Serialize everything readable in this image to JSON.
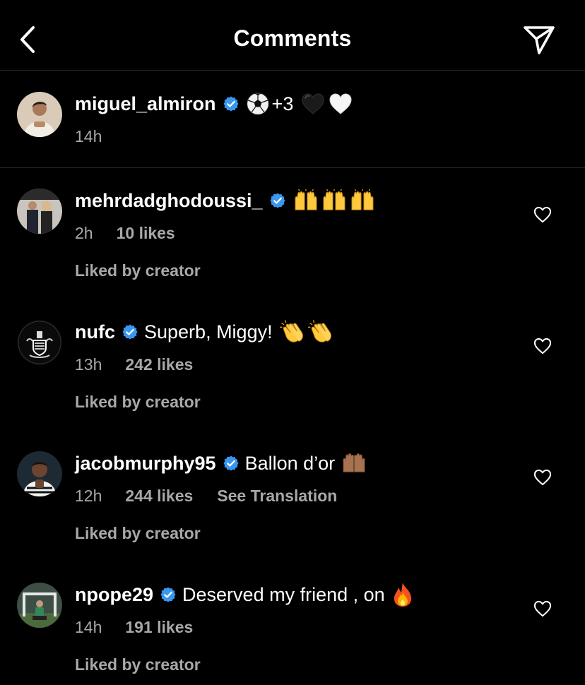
{
  "header": {
    "title": "Comments",
    "back_icon": "chevron-left-icon",
    "share_icon": "paper-plane-icon"
  },
  "caption": {
    "username": "miguel_almiron",
    "verified": true,
    "text": "+3",
    "emojis_before": [
      "soccer-ball"
    ],
    "emojis_after": [
      "black-heart",
      "white-heart"
    ],
    "time": "14h"
  },
  "comments": [
    {
      "username": "mehrdadghodoussi_",
      "verified": true,
      "text": "",
      "emojis": [
        "raising-hands",
        "raising-hands",
        "raising-hands"
      ],
      "time": "2h",
      "likes": "10 likes",
      "liked_by": "Liked by creator"
    },
    {
      "username": "nufc",
      "verified": true,
      "text": "Superb, Miggy!",
      "emojis": [
        "clapping-hands",
        "clapping-hands"
      ],
      "time": "13h",
      "likes": "242 likes",
      "liked_by": "Liked by creator"
    },
    {
      "username": "jacobmurphy95",
      "verified": true,
      "text": "Ballon d’or",
      "emojis": [
        "palms-up"
      ],
      "time": "12h",
      "likes": "244 likes",
      "translate": "See Translation",
      "liked_by": "Liked by creator"
    },
    {
      "username": "npope29",
      "verified": true,
      "text": "Deserved my friend , on",
      "emojis": [
        "fire"
      ],
      "time": "14h",
      "likes": "191 likes",
      "liked_by": "Liked by creator"
    }
  ],
  "colors": {
    "background": "#000000",
    "text": "#ffffff",
    "secondary": "#a8a8a8",
    "verified": "#3897f0",
    "divider": "#262626"
  }
}
